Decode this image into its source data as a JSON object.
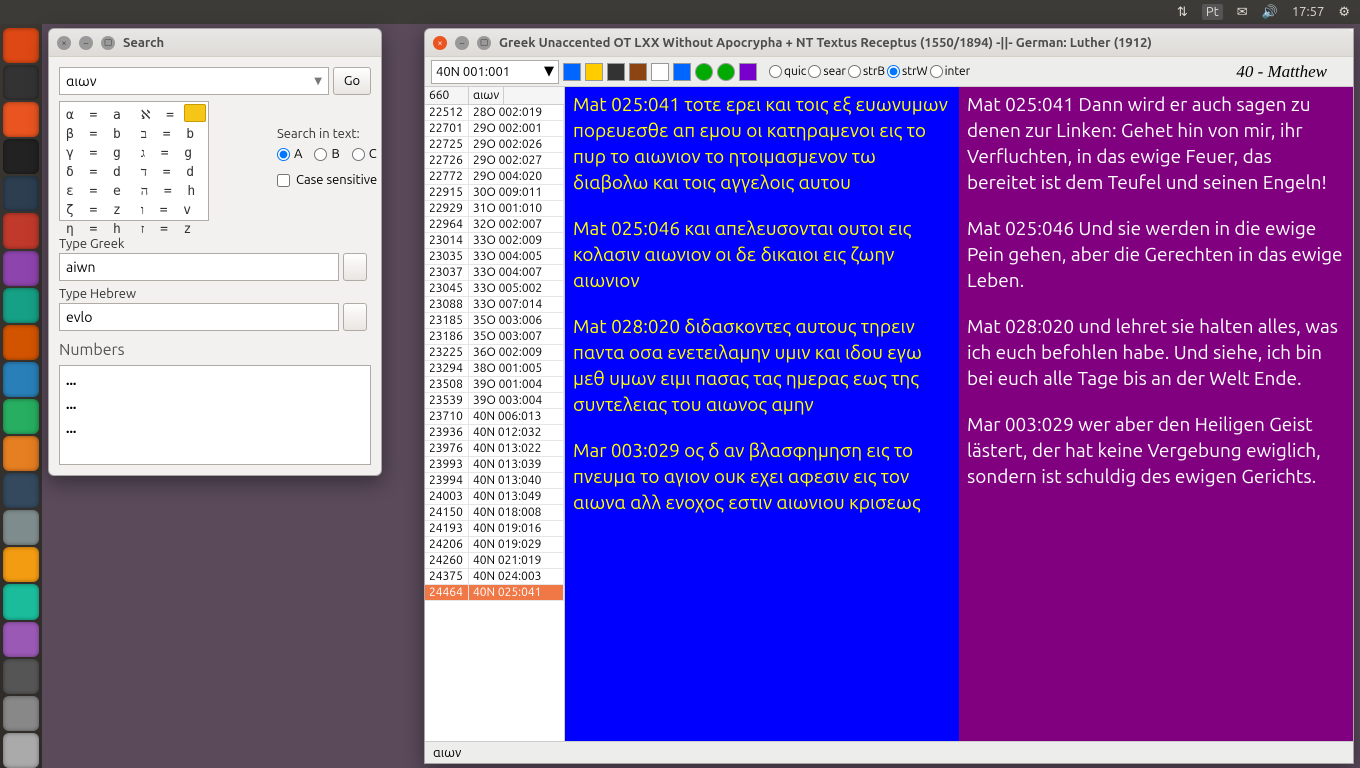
{
  "menubar": {
    "time": "17:57",
    "keyboard": "Pt"
  },
  "search_window": {
    "title": "Search",
    "query": "αιων",
    "go": "Go",
    "alpha_left": "α  =  a\nβ  =  b\nγ  =  g\nδ  =  d\nε  =  e\nζ  =  z\nη  =  h",
    "alpha_right": "ℵ  =  a\nב  =  b\nג  =  g\nד  =  d\nה  =  h\nו  =  v\nז  =  z",
    "search_in_text": "Search in text:",
    "radio_a": "A",
    "radio_b": "B",
    "radio_c": "C",
    "case_sensitive": "Case sensitive",
    "type_greek_label": "Type Greek",
    "type_greek_value": "aiwn",
    "type_hebrew_label": "Type Hebrew",
    "type_hebrew_value": "evlo",
    "numbers_label": "Numbers",
    "numbers": [
      "...",
      "...",
      "..."
    ]
  },
  "main_window": {
    "title": "Greek Unaccented OT LXX Without Apocrypha + NT Textus Receptus (1550/1894)   -||-   German: Luther (1912)",
    "verse_ref": "40N 001:001",
    "radios": {
      "quic": "quic",
      "sear": "sear",
      "strB": "strB",
      "strW": "strW",
      "inter": "inter"
    },
    "book": "40 - Matthew",
    "ref_header": {
      "c1": "660",
      "c2": "αιων"
    },
    "refs": [
      {
        "n": "22512",
        "r": "28O 002:019"
      },
      {
        "n": "22701",
        "r": "29O 002:001"
      },
      {
        "n": "22725",
        "r": "29O 002:026"
      },
      {
        "n": "22726",
        "r": "29O 002:027"
      },
      {
        "n": "22772",
        "r": "29O 004:020"
      },
      {
        "n": "22915",
        "r": "30O 009:011"
      },
      {
        "n": "22929",
        "r": "31O 001:010"
      },
      {
        "n": "22964",
        "r": "32O 002:007"
      },
      {
        "n": "23014",
        "r": "33O 002:009"
      },
      {
        "n": "23035",
        "r": "33O 004:005"
      },
      {
        "n": "23037",
        "r": "33O 004:007"
      },
      {
        "n": "23045",
        "r": "33O 005:002"
      },
      {
        "n": "23088",
        "r": "33O 007:014"
      },
      {
        "n": "23185",
        "r": "35O 003:006"
      },
      {
        "n": "23186",
        "r": "35O 003:007"
      },
      {
        "n": "23225",
        "r": "36O 002:009"
      },
      {
        "n": "23294",
        "r": "38O 001:005"
      },
      {
        "n": "23508",
        "r": "39O 001:004"
      },
      {
        "n": "23539",
        "r": "39O 003:004"
      },
      {
        "n": "23710",
        "r": "40N 006:013"
      },
      {
        "n": "23936",
        "r": "40N 012:032"
      },
      {
        "n": "23976",
        "r": "40N 013:022"
      },
      {
        "n": "23993",
        "r": "40N 013:039"
      },
      {
        "n": "23994",
        "r": "40N 013:040"
      },
      {
        "n": "24003",
        "r": "40N 013:049"
      },
      {
        "n": "24150",
        "r": "40N 018:008"
      },
      {
        "n": "24193",
        "r": "40N 019:016"
      },
      {
        "n": "24206",
        "r": "40N 019:029"
      },
      {
        "n": "24260",
        "r": "40N 021:019"
      },
      {
        "n": "24375",
        "r": "40N 024:003"
      },
      {
        "n": "24464",
        "r": "40N 025:041",
        "sel": true
      }
    ],
    "greek": [
      "Mat 025:041 τοτε ερει και τοις εξ ευωνυμων πορευεσθε απ εμου οι κατηραμενοι εις το πυρ το αιωνιον το ητοιμασμενον τω διαβολω και τοις αγγελοις αυτου",
      "Mat 025:046 και απελευσονται ουτοι εις κολασιν αιωνιον οι δε δικαιοι εις ζωην αιωνιον",
      "Mat 028:020 διδασκοντες αυτους τηρειν παντα οσα ενετειλαμην υμιν και ιδου εγω μεθ υμων ειμι πασας τας ημερας εως της συντελειας του αιωνος αμην",
      "Mar 003:029 ος δ αν βλασφημηση εις το πνευμα το αγιον ουκ εχει αφεσιν εις τον αιωνα αλλ ενοχος εστιν αιωνιου κρισεως"
    ],
    "german": [
      "Mat 025:041 Dann wird er auch sagen zu denen zur Linken: Gehet hin von mir, ihr Verfluchten, in das ewige Feuer, das bereitet ist dem Teufel und seinen Engeln!",
      "Mat 025:046 Und sie werden in die ewige Pein gehen, aber die Gerechten in das ewige Leben.",
      "Mat 028:020 und lehret sie halten alles, was ich euch befohlen habe. Und siehe, ich bin bei euch alle Tage bis an der Welt Ende.",
      "Mar 003:029 wer aber den Heiligen Geist lästert, der hat keine Vergebung ewiglich, sondern ist schuldig des ewigen Gerichts."
    ],
    "status": "αιων"
  }
}
